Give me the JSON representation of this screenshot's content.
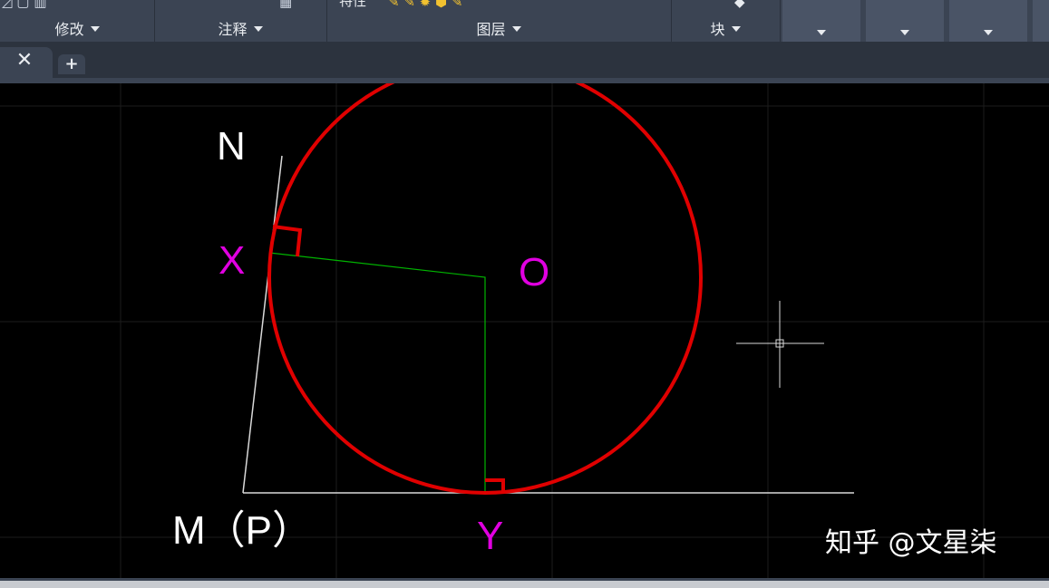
{
  "ribbon": {
    "panels": [
      {
        "id": "modify",
        "title": "修改"
      },
      {
        "id": "annotate",
        "title": "注释"
      },
      {
        "id": "layers",
        "title": "图层",
        "top_label": "特性"
      },
      {
        "id": "block",
        "title": "块"
      }
    ]
  },
  "tabs": {
    "close_glyph": "✕",
    "new_glyph": "+"
  },
  "drawing": {
    "labels": {
      "N": "N",
      "X": "X",
      "O": "O",
      "M": "M（P）",
      "Y": "Y"
    },
    "colors": {
      "circle": "#e00000",
      "construction": "#00b400",
      "lines": "#d9d9d9",
      "magenta": "#e000e0",
      "white": "#ffffff",
      "grid": "#1c1c1c"
    }
  },
  "watermark": {
    "text": "知乎 @文星柒"
  }
}
